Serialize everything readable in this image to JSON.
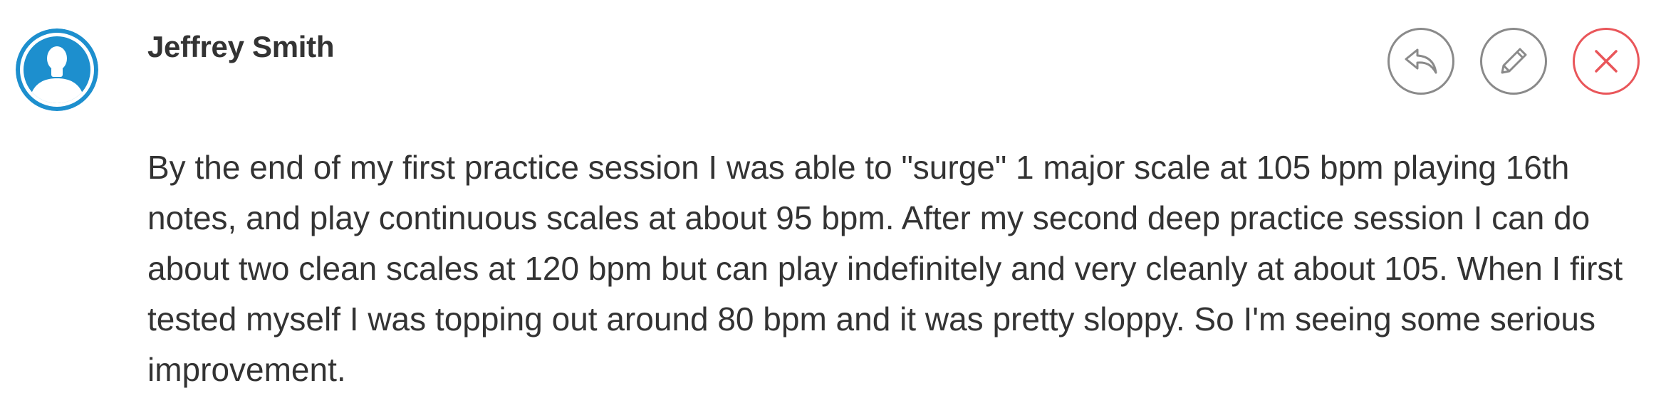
{
  "comment": {
    "author": "Jeffrey Smith",
    "text": "By the end of my first practice session I was able to \"surge\" 1 major scale at 105 bpm playing 16th notes, and play continuous scales at about 95 bpm. After my second deep practice session I can do about two clean scales at 120 bpm but can play indefinitely and very cleanly at about 105. When I first tested myself I was topping out around 80 bpm and it was pretty sloppy. So I'm seeing some serious improvement.",
    "avatar_icon": "user-silhouette-icon",
    "actions": [
      {
        "icon": "reply-icon"
      },
      {
        "icon": "pencil-icon"
      },
      {
        "icon": "close-icon"
      }
    ]
  },
  "colors": {
    "avatar": "#1d8fce",
    "action_border": "#8a8a8a",
    "delete_accent": "#e9565a",
    "text": "#333333"
  }
}
